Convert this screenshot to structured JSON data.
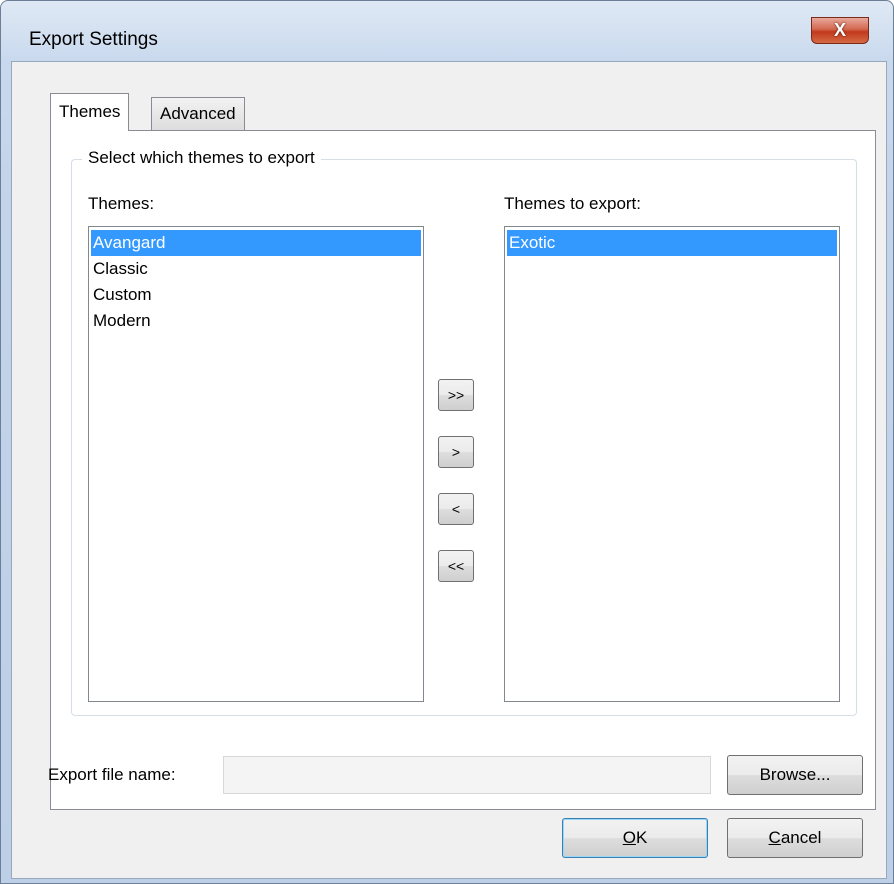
{
  "window": {
    "title": "Export Settings",
    "close_glyph": "X"
  },
  "tabs": [
    {
      "label": "Themes",
      "active": true
    },
    {
      "label": "Advanced",
      "active": false
    }
  ],
  "group": {
    "label": "Select which themes to export"
  },
  "available": {
    "label": "Themes:",
    "items": [
      "Avangard",
      "Classic",
      "Custom",
      "Modern"
    ],
    "selected": "Avangard"
  },
  "export": {
    "label": "Themes to export:",
    "items": [
      "Exotic"
    ],
    "selected": "Exotic"
  },
  "move_buttons": {
    "add_all": ">>",
    "add": ">",
    "remove": "<",
    "remove_all": "<<"
  },
  "file": {
    "label": "Export file name:",
    "value": "",
    "browse": "Browse..."
  },
  "footer": {
    "ok_mnemonic": "O",
    "ok_rest": "K",
    "cancel_mnemonic": "C",
    "cancel_rest": "ancel"
  },
  "colors": {
    "selection": "#3399ff",
    "close_button": "#c2391c"
  }
}
